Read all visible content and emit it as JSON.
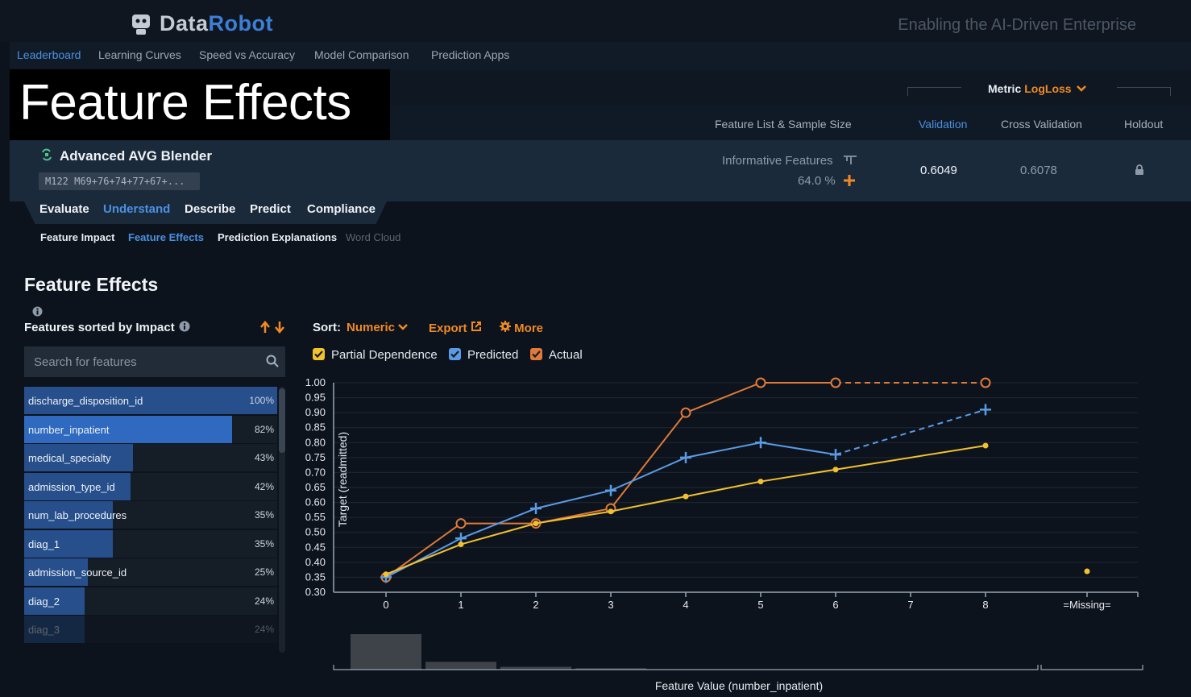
{
  "header": {
    "brand_part1": "Data",
    "brand_part2": "Robot",
    "tagline": "Enabling the AI-Driven Enterprise",
    "logo_icon": "robot-head-icon"
  },
  "nav": {
    "items": [
      "Leaderboard",
      "Learning Curves",
      "Speed vs Accuracy",
      "Model Comparison",
      "Prediction Apps"
    ],
    "active": "Leaderboard"
  },
  "toolbar": {
    "metric_label": "Metric",
    "metric_value": "LogLoss"
  },
  "overlay_title": "Feature Effects",
  "columns": {
    "feature_list": "Feature List & Sample Size",
    "validation": "Validation",
    "cross_validation": "Cross Validation",
    "holdout": "Holdout"
  },
  "model": {
    "name": "Advanced AVG Blender",
    "badge": "M122  M69+76+74+77+67+...",
    "feature_list": "Informative Features",
    "sample_pct": "64.0 %",
    "validation": "0.6049",
    "cross_validation": "0.6078"
  },
  "tabs": [
    "Evaluate",
    "Understand",
    "Describe",
    "Predict",
    "Compliance"
  ],
  "active_tab": "Understand",
  "subtabs": [
    "Feature Impact",
    "Feature Effects",
    "Prediction Explanations",
    "Word Cloud"
  ],
  "active_subtab": "Feature Effects",
  "section": {
    "title": "Feature Effects",
    "sorted_label": "Features sorted by Impact",
    "search_placeholder": "Search for features"
  },
  "features": [
    {
      "name": "discharge_disposition_id",
      "pct": "100%",
      "fraction": 1.0
    },
    {
      "name": "number_inpatient",
      "pct": "82%",
      "fraction": 0.82
    },
    {
      "name": "medical_specialty",
      "pct": "43%",
      "fraction": 0.43
    },
    {
      "name": "admission_type_id",
      "pct": "42%",
      "fraction": 0.42
    },
    {
      "name": "num_lab_procedures",
      "pct": "35%",
      "fraction": 0.35
    },
    {
      "name": "diag_1",
      "pct": "35%",
      "fraction": 0.35
    },
    {
      "name": "admission_source_id",
      "pct": "25%",
      "fraction": 0.25
    },
    {
      "name": "diag_2",
      "pct": "24%",
      "fraction": 0.24
    },
    {
      "name": "diag_3",
      "pct": "24%",
      "fraction": 0.24
    }
  ],
  "selected_feature": "number_inpatient",
  "controls": {
    "sort_label": "Sort:",
    "sort_value": "Numeric",
    "export": "Export",
    "more": "More"
  },
  "legend": {
    "partial_dependence": "Partial Dependence",
    "predicted": "Predicted",
    "actual": "Actual"
  },
  "colors": {
    "accent_blue": "#4a90e2",
    "accent_orange": "#f08a24",
    "partial_dependence": "#f2c12e",
    "predicted": "#5a9be6",
    "actual": "#e07a3a"
  },
  "chart_data": {
    "type": "line",
    "xlabel": "Feature Value (number_inpatient)",
    "ylabel": "Target (readmitted)",
    "x_ticks": [
      "0",
      "1",
      "2",
      "3",
      "4",
      "5",
      "6",
      "7",
      "8",
      "=Missing="
    ],
    "y_ticks": [
      "0.30",
      "0.35",
      "0.40",
      "0.45",
      "0.50",
      "0.55",
      "0.60",
      "0.65",
      "0.70",
      "0.75",
      "0.80",
      "0.85",
      "0.90",
      "0.95",
      "1.00"
    ],
    "ylim": [
      0.3,
      1.0
    ],
    "xlim": [
      0,
      8
    ],
    "series": [
      {
        "name": "Partial Dependence",
        "x": [
          0,
          1,
          2,
          3,
          4,
          5,
          6,
          8
        ],
        "y": [
          0.36,
          0.46,
          0.53,
          0.57,
          0.62,
          0.67,
          0.71,
          0.79
        ],
        "missing": 0.37
      },
      {
        "name": "Predicted",
        "x": [
          0,
          1,
          2,
          3,
          4,
          5,
          6,
          8
        ],
        "y": [
          0.35,
          0.48,
          0.58,
          0.64,
          0.75,
          0.8,
          0.76,
          0.91
        ],
        "dashed_from_index": 6
      },
      {
        "name": "Actual",
        "x": [
          0,
          1,
          2,
          3,
          4,
          5,
          6,
          8
        ],
        "y": [
          0.35,
          0.53,
          0.53,
          0.58,
          0.9,
          1.0,
          1.0,
          1.0
        ],
        "dashed_from_index": 6
      }
    ],
    "histogram": {
      "x": [
        0,
        1,
        2,
        3
      ],
      "relative_counts": [
        1.0,
        0.22,
        0.08,
        0.04
      ]
    },
    "grid": true
  }
}
